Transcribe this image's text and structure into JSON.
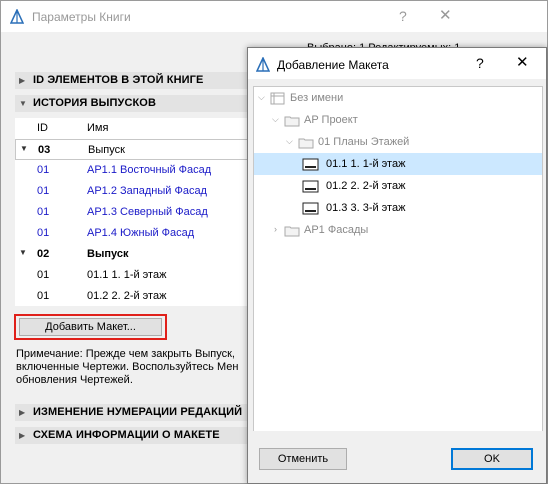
{
  "back_dialog": {
    "title": "Параметры Книги",
    "help": "?",
    "close": "✕",
    "selected_info": "Выбрано: 1 Редактируемых: 1",
    "sections": {
      "id_elements": "ID ЭЛЕМЕНТОВ В ЭТОЙ КНИГЕ",
      "issue_history": "ИСТОРИЯ ВЫПУСКОВ",
      "revision_numbering": "ИЗМЕНЕНИЕ НУМЕРАЦИИ РЕДАКЦИЙ",
      "layout_info_scheme": "СХЕМА ИНФОРМАЦИИ О МАКЕТЕ"
    },
    "table": {
      "col_id": "ID",
      "col_name": "Имя",
      "rows": [
        {
          "id": "03",
          "name": "Выпуск"
        },
        {
          "id": "01",
          "name": "AP1.1 Восточный Фасад"
        },
        {
          "id": "01",
          "name": "AP1.2 Западный Фасад"
        },
        {
          "id": "01",
          "name": "AP1.3 Северный Фасад"
        },
        {
          "id": "01",
          "name": "AP1.4 Южный Фасад"
        },
        {
          "id": "02",
          "name": "Выпуск"
        },
        {
          "id": "01",
          "name": "01.1 1. 1-й этаж"
        },
        {
          "id": "01",
          "name": "01.2 2. 2-й этаж"
        }
      ]
    },
    "add_layout_button": "Добавить Макет...",
    "note": "Примечание: Прежде чем закрыть Выпуск, включенные Чертежи. Воспользуйтесь Мен обновления Чертежей."
  },
  "front_dialog": {
    "title": "Добавление Макета",
    "help": "?",
    "close": "✕",
    "tree": [
      {
        "label": "Без имени"
      },
      {
        "label": "AP Проект"
      },
      {
        "label": "01 Планы Этажей"
      },
      {
        "label": "01.1 1. 1-й этаж"
      },
      {
        "label": "01.2 2. 2-й этаж"
      },
      {
        "label": "01.3 3. 3-й этаж"
      },
      {
        "label": "AP1 Фасады"
      }
    ],
    "cancel_button": "Отменить",
    "ok_button": "OK"
  },
  "colors": {
    "link_blue": "#1a1ac8",
    "highlight_red": "#e0201a",
    "selection": "#cce8ff"
  }
}
